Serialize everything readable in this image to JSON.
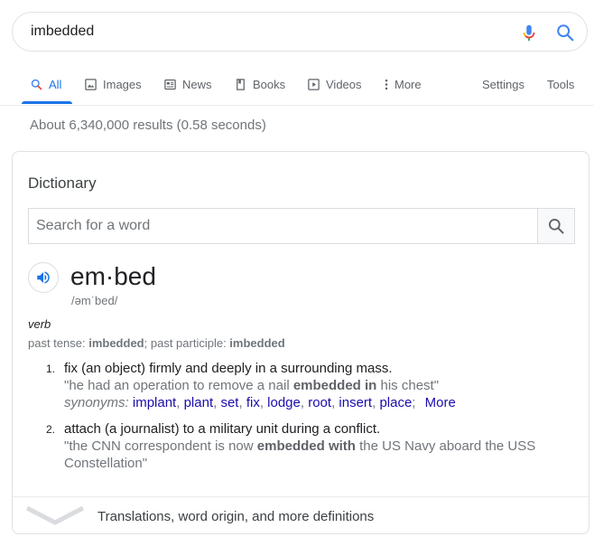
{
  "search": {
    "query": "imbedded"
  },
  "tabs": [
    {
      "label": "All",
      "icon": "search-icon",
      "active": true
    },
    {
      "label": "Images",
      "icon": "image-icon"
    },
    {
      "label": "News",
      "icon": "news-icon"
    },
    {
      "label": "Books",
      "icon": "book-icon"
    },
    {
      "label": "Videos",
      "icon": "video-icon"
    },
    {
      "label": "More",
      "icon": "more-vert-icon"
    },
    {
      "label": "Settings"
    },
    {
      "label": "Tools"
    }
  ],
  "stats": "About 6,340,000 results (0.58 seconds)",
  "dictionary": {
    "title": "Dictionary",
    "search_placeholder": "Search for a word",
    "headword": "em·bed",
    "phonetic": "/əmˈbed/",
    "part_of_speech": "verb",
    "forms": {
      "past_tense_label": "past tense: ",
      "past_tense": "imbedded",
      "sep": "; ",
      "past_participle_label": "past participle: ",
      "past_participle": "imbedded"
    },
    "definitions": [
      {
        "num": "1.",
        "text": "fix (an object) firmly and deeply in a surrounding mass.",
        "example_pre": "\"he had an operation to remove a nail ",
        "example_bold": "embedded in",
        "example_post": " his chest\"",
        "synonyms_label": "synonyms:",
        "synonyms": [
          "implant",
          "plant",
          "set",
          "fix",
          "lodge",
          "root",
          "insert",
          "place"
        ],
        "more": "More"
      },
      {
        "num": "2.",
        "text": "attach (a journalist) to a military unit during a conflict.",
        "example_pre": "\"the CNN correspondent is now ",
        "example_bold": "embedded with",
        "example_post": " the US Navy aboard the USS Constellation\""
      }
    ],
    "more_definitions": "Translations, word origin, and more definitions"
  },
  "colors": {
    "accent": "#1a73e8",
    "link": "#1a0dab",
    "muted": "#70757a"
  }
}
